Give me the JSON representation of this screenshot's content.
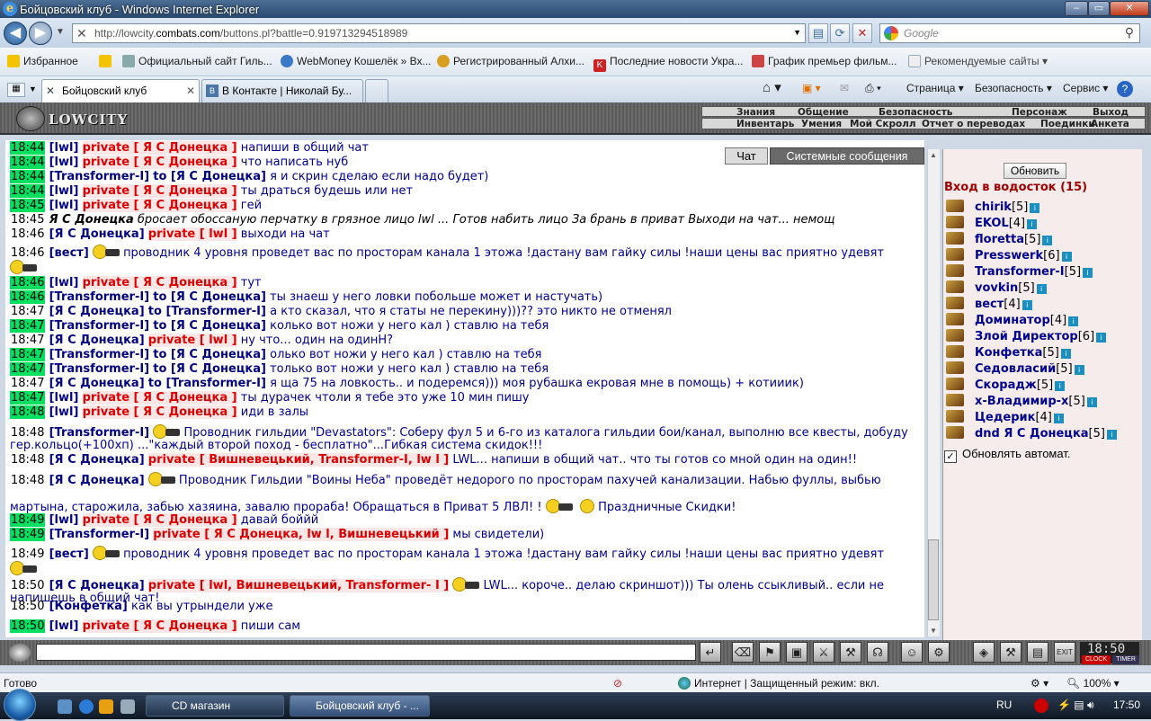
{
  "window": {
    "title": "Бойцовский клуб - Windows Internet Explorer"
  },
  "address": {
    "url_prefix": "http://lowcity.",
    "url_domain": "combats.com",
    "url_path": "/buttons.pl?battle=0.919713294518989",
    "search_placeholder": "Google"
  },
  "favorites": {
    "label": "Избранное",
    "items": [
      "Официальный сайт Гиль...",
      "WebMoney Кошелёк » Вх...",
      "Регистрированный Алхи...",
      "Последние новости Укра...",
      "График премьер фильм...",
      "Рекомендуемые сайты"
    ]
  },
  "tabs": [
    {
      "label": "Бойцовский клуб"
    },
    {
      "label": "В Контакте | Николай Бу..."
    }
  ],
  "commandbar": {
    "page": "Страница",
    "safety": "Безопасность",
    "service": "Сервис"
  },
  "game": {
    "logo_text": "LOWCITY",
    "menu_top": [
      "Знания",
      "Общение",
      "Безопасность",
      "Персонаж",
      "Выход"
    ],
    "menu_bottom": [
      "Инвентарь",
      "Умения",
      "Мой Скролл",
      "Отчет о переводах",
      "Поединки",
      "Анкета"
    ]
  },
  "chat_tabs": {
    "chat": "Чат",
    "system": "Системные сообщения"
  },
  "chat": {
    "lines": [
      {
        "t": "18:44",
        "nick": "[lwl]",
        "priv": "private [ Я С Донецка ]",
        "msg": "напиши в общий чат"
      },
      {
        "t": "18:44",
        "nick": "[lwl]",
        "priv": "private [ Я С Донецка ]",
        "msg": "что написать нуб"
      },
      {
        "t": "18:44",
        "nick": "[Transformer-I]",
        "to": "to [Я С Донецка]",
        "msg": "я и скрин сделаю если надо будет)"
      },
      {
        "t": "18:44",
        "nick": "[lwl]",
        "priv": "private [ Я С Донецка ]",
        "msg": "ты драться будешь или нет"
      },
      {
        "t": "18:45",
        "nick": "[lwl]",
        "priv": "private [ Я С Донецка ]",
        "msg": "гей"
      },
      {
        "t": "18:45",
        "emote_nick": "Я С Донецка",
        "emote": "бросает обоссаную перчатку в грязное лицо lwl ... Готов набить лицо За брань в приват Выходи на чат... немощ"
      },
      {
        "t": "18:46",
        "nick": "[Я С Донецка]",
        "priv": "private [ lwl ]",
        "msg": "выходи на чат"
      },
      {
        "t": "18:46",
        "nick": "[вест]",
        "msg": "проводник 4 уровня проведет вас по просторам канала 1 этожа !дастану вам гайку силы !наши цены вас приятно удевят"
      },
      {
        "t": "18:46",
        "nick": "[lwl]",
        "priv": "private [ Я С Донецка ]",
        "msg": "тут"
      },
      {
        "t": "18:46",
        "nick": "[Transformer-I]",
        "to": "to [Я С Донецка]",
        "msg": "ты знаеш у него ловки побольше может и настучать)"
      },
      {
        "t": "18:47",
        "nick": "[Я С Донецка]",
        "to": "to [Transformer-I]",
        "msg": "а кто сказал, что я статы не перекину)))?? это никто не отменял"
      },
      {
        "t": "18:47",
        "nick": "[Transformer-I]",
        "to": "to [Я С Донецка]",
        "msg": "колько вот ножи у него кал ) ставлю на тебя"
      },
      {
        "t": "18:47",
        "nick": "[Я С Донецка]",
        "priv": "private [ lwl ]",
        "msg": "ну что... один на одинН?"
      },
      {
        "t": "18:47",
        "nick": "[Transformer-I]",
        "to": "to [Я С Донецка]",
        "msg": "олько вот ножи у него кал ) ставлю на тебя"
      },
      {
        "t": "18:47",
        "nick": "[Transformer-I]",
        "to": "to [Я С Донецка]",
        "msg": "только вот ножи у него кал ) ставлю на тебя"
      },
      {
        "t": "18:47",
        "nick": "[Я С Донецка]",
        "to": "to [Transformer-I]",
        "msg": "я ща 75 на ловкость.. и подеремся))) моя рубашка екровая мне в помощь) + котииик)"
      },
      {
        "t": "18:47",
        "nick": "[lwl]",
        "priv": "private [ Я С Донецка ]",
        "msg": "ты дурачек чтоли я тебе это уже 10 мин пишу"
      },
      {
        "t": "18:48",
        "nick": "[lwl]",
        "priv": "private [ Я С Донецка ]",
        "msg": "иди в залы"
      },
      {
        "t": "18:48",
        "nick": "[Transformer-I]",
        "msg": "Проводник гильдии \"Devastators\": Соберу фул 5 и 6-го из каталога гильдии бои/канал, выполню все квесты, добуду",
        "msg2": "гер.кольцо(+100хп) ...\"каждый второй поход - бесплатно\"...Гибкая система скидок!!!"
      },
      {
        "t": "18:48",
        "nick": "[Я С Донецка]",
        "priv": "private [ Вишневецький, Transformer-I, lw l ]",
        "msg": "LWL... напиши в общий чат.. что ты готов со мной один на один!!"
      },
      {
        "t": "18:48",
        "nick": "[Я С Донецка]",
        "msg": "Проводник Гильдии \"Воины Неба\" проведёт недорого по просторам пахучей канализации. Набью фуллы, выбью",
        "msg2": "мартына, старожила, забью хазяина, завалю прораба! Обращаться в Приват 5 ЛВЛ! !",
        "msg3": "Праздничные Скидки!"
      },
      {
        "t": "18:49",
        "nick": "[lwl]",
        "priv": "private [ Я С Донецка ]",
        "msg": "давай боййй"
      },
      {
        "t": "18:49",
        "nick": "[Transformer-I]",
        "priv": "private [ Я С Донецка, lw l, Вишневецький ]",
        "msg": "мы свидетели)"
      },
      {
        "t": "18:49",
        "nick": "[вест]",
        "msg": "проводник 4 уровня проведет вас по просторам канала 1 этожа !дастану вам гайку силы !наши цены вас приятно удевят"
      },
      {
        "t": "18:50",
        "nick": "[Я С Донецка]",
        "priv": "private [ lwl, Вишневецький, Transformer- I ]",
        "msg": "LWL... короче.. делаю скриншот))) Ты олень ссыкливый.. если не",
        "msg2": "напишешь в общий чат!"
      },
      {
        "t": "18:50",
        "nick": "[Конфетка]",
        "msg": "как вы утрындели ужe"
      },
      {
        "t": "18:50",
        "nick": "[lwl]",
        "priv": "private [ Я С Донецка ]",
        "msg": "пиши сам"
      }
    ]
  },
  "sidebar": {
    "refresh_label": "Обновить",
    "room_title": "Вход в водосток (15)",
    "users": [
      {
        "name": "chirik",
        "level": "[5]"
      },
      {
        "name": "EKOL",
        "level": "[4]"
      },
      {
        "name": "floretta",
        "level": "[5]"
      },
      {
        "name": "Presswerk",
        "level": "[6]"
      },
      {
        "name": "Transformer-I",
        "level": "[5]"
      },
      {
        "name": "vovkin",
        "level": "[5]"
      },
      {
        "name": "вест",
        "level": "[4]"
      },
      {
        "name": "Доминатор",
        "level": "[4]"
      },
      {
        "name": "Злой Директор",
        "level": "[6]"
      },
      {
        "name": "Конфетка",
        "level": "[5]"
      },
      {
        "name": "Седовласий",
        "level": "[5]"
      },
      {
        "name": "Скорадж",
        "level": "[5]"
      },
      {
        "name": "x-Владимир-x",
        "level": "[5]"
      },
      {
        "name": "Цедерик",
        "level": "[4]"
      },
      {
        "name": "dnd Я С Донецка",
        "level": "[5]"
      }
    ],
    "auto_refresh_label": "Обновлять автомат.",
    "auto_refresh_checked": "✓"
  },
  "clock": {
    "time": "18:50",
    "clock_label": "CLOCK",
    "timer_label": "TIMER"
  },
  "status": {
    "left": "Готово",
    "zone": "Интернет | Защищенный режим: вкл.",
    "zoom": "100%"
  },
  "taskbar": {
    "buttons": [
      "CD магазин",
      "Бойцовский клуб - ..."
    ],
    "lang": "RU",
    "time": "17:50"
  }
}
